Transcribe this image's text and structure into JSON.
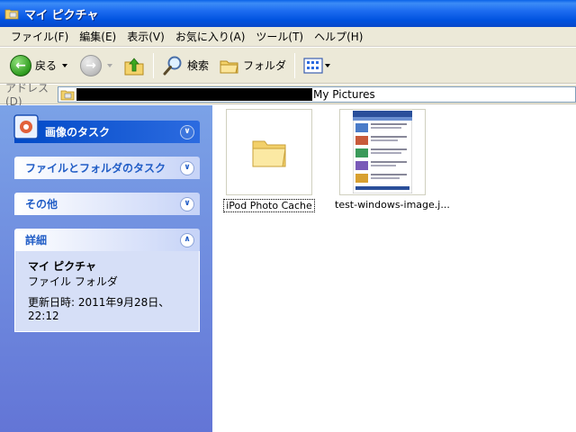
{
  "window": {
    "title": "マイ ピクチャ"
  },
  "menu": [
    "ファイル(F)",
    "編集(E)",
    "表示(V)",
    "お気に入り(A)",
    "ツール(T)",
    "ヘルプ(H)"
  ],
  "toolbar": {
    "back_label": "戻る",
    "search_label": "検索",
    "folders_label": "フォルダ"
  },
  "address": {
    "label": "アドレス(D)",
    "path_visible": "My Pictures"
  },
  "taskpane": {
    "image_tasks": "画像のタスク",
    "file_folder_tasks": "ファイルとフォルダのタスク",
    "other": "その他",
    "details": {
      "header": "詳細",
      "name": "マイ ピクチャ",
      "type": "ファイル フォルダ",
      "modified": "更新日時: 2011年9月28日、22:12"
    }
  },
  "files": [
    {
      "name": "iPod Photo Cache",
      "kind": "folder"
    },
    {
      "name": "test-windows-image.j...",
      "kind": "image"
    }
  ],
  "colors": {
    "title_bar": "#0052df",
    "task_pane": "#6375d6",
    "panel_title": "#215dc6"
  }
}
